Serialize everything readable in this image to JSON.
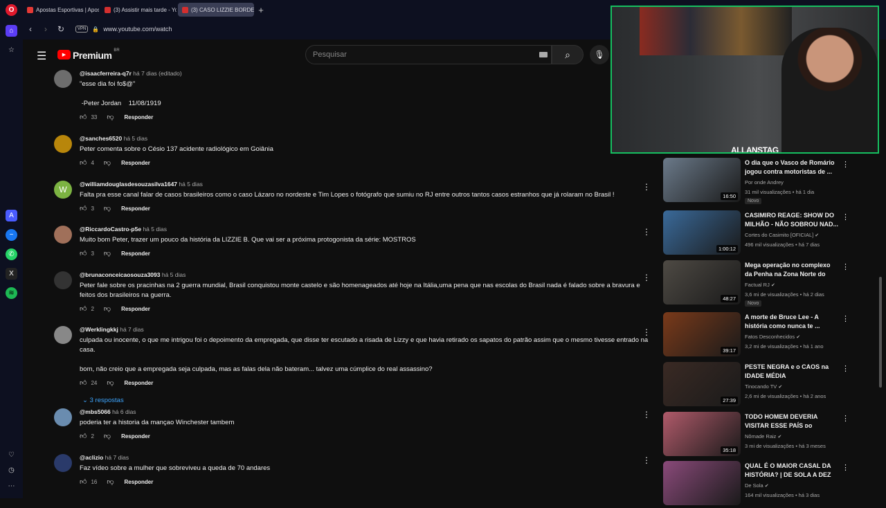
{
  "browser": {
    "tabs": [
      {
        "label": "Apostas Esportivas | Apos"
      },
      {
        "label": "(3) Assistir mais tarde - Yo"
      },
      {
        "label": "(3) CASO LIZZIE BORDEN"
      }
    ],
    "new_tab": "+",
    "url": "www.youtube.com/watch",
    "vpn": "VPN"
  },
  "youtube": {
    "logo": "Premium",
    "logo_region": "BR",
    "search_placeholder": "Pesquisar"
  },
  "comments": [
    {
      "user": "@isaacferreira-q7r",
      "time": "há 7 dias (editado)",
      "text": "\"esse dia foi fo$@\"\n\n -Peter Jordan    11/08/1919",
      "likes": "33",
      "reply": "Responder"
    },
    {
      "user": "@sanches6520",
      "time": "há 5 dias",
      "text": "Peter comenta sobre o Césio 137 acidente radiológico em Goiânia",
      "likes": "4",
      "reply": "Responder"
    },
    {
      "user": "@williamdouglasdesouzasilva1647",
      "time": "há 5 dias",
      "text": "Falta pra esse canal falar de casos brasileiros como o caso Lázaro no nordeste e Tim Lopes o fotógrafo que sumiu no RJ entre outros tantos casos estranhos que já rolaram no Brasil !",
      "likes": "3",
      "reply": "Responder",
      "avatar_letter": "W"
    },
    {
      "user": "@RiccardoCastro-p5e",
      "time": "há 5 dias",
      "text": "Muito bom Peter, trazer um pouco da história da LIZZIE B. Que vai ser a próxima protogonista da série: MOSTROS",
      "likes": "3",
      "reply": "Responder"
    },
    {
      "user": "@brunaconceicaosouza3093",
      "time": "há 5 dias",
      "text": "Peter fale sobre os pracinhas na 2 guerra mundial, Brasil conquistou monte castelo e são homenageados até hoje na Itália,uma pena que nas escolas do Brasil nada é falado sobre a bravura e feitos dos brasileiros na guerra.",
      "likes": "2",
      "reply": "Responder"
    },
    {
      "user": "@Werklingkkj",
      "time": "há 7 dias",
      "text": "culpada ou inocente, o que me intrigou foi o depoimento da empregada, que disse ter escutado a risada de Lizzy e que havia retirado os sapatos do patrão assim que o mesmo tivesse entrado na casa.\n\nbom, não creio que a empregada seja culpada, mas as falas dela não bateram... talvez uma cúmplice do real assassino?",
      "likes": "24",
      "reply": "Responder",
      "replies": "3 respostas"
    },
    {
      "user": "@mbs5066",
      "time": "há 6 dias",
      "text": "poderia ter a historia da mançao Winchester tambem",
      "likes": "2",
      "reply": "Responder"
    },
    {
      "user": "@aclizio",
      "time": "há 7 dias",
      "text": "Faz vídeo sobre a mulher que sobreviveu a queda de 70 andares",
      "likes": "16",
      "reply": "Responder"
    }
  ],
  "webcam": {
    "name": "ALLANSTAG"
  },
  "recommendations": [
    {
      "title": "O dia que o Vasco de Romário jogou contra motoristas de ...",
      "channel": "Por onde Andrey",
      "meta": "31 mil visualizações • há 1 dia",
      "duration": "16:50",
      "badge": "Novo",
      "thumb_color": "#6b7a8a"
    },
    {
      "title": "CASIMIRO REAGE: SHOW DO MILHÃO - NÃO SOBROU NAD...",
      "channel": "Cortes do Casimito [OFICIAL]",
      "meta": "496 mil visualizações • há 7 dias",
      "duration": "1:00:12",
      "thumb_color": "#3a6a9a"
    },
    {
      "title": "Mega operação no complexo da Penha  na Zona Norte do R.J. ...",
      "channel": "Factual RJ",
      "meta": "3,6 mi de visualizações • há 2 dias",
      "duration": "48:27",
      "badge": "Novo",
      "thumb_color": "#4e4a44"
    },
    {
      "title": "A morte de Bruce Lee - A história como nunca te ...",
      "channel": "Fatos Desconhecidos",
      "meta": "3,2 mi de visualizações • há 1 ano",
      "duration": "39:17",
      "thumb_color": "#7a3a1a"
    },
    {
      "title": "PESTE NEGRA e o CAOS na IDADE MÉDIA",
      "channel": "Tinocando TV",
      "meta": "2,6 mi de visualizações • há 2 anos",
      "duration": "27:39",
      "thumb_color": "#3a2a24"
    },
    {
      "title": "TODO HOMEM DEVERIA VISITAR ESSE PAÍS ᴅᴏ",
      "channel": "Nômade Raiz",
      "meta": "3 mi de visualizações • há 3 meses",
      "duration": "35:18",
      "thumb_color": "#b05a6a"
    },
    {
      "title": "QUAL É O MAIOR CASAL DA HISTÓRIA? | DE SOLA A DEZ",
      "channel": "De Sola",
      "meta": "164 mil visualizações • há 3 dias",
      "duration": "",
      "thumb_color": "#8a4a7a"
    }
  ]
}
